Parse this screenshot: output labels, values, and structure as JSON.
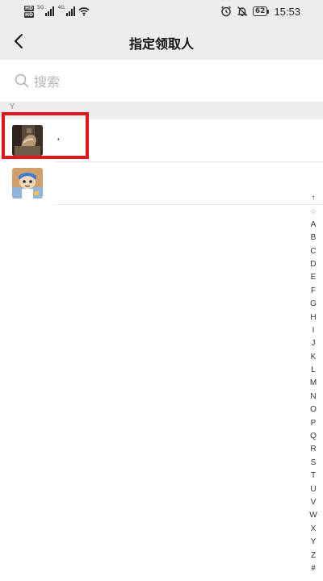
{
  "status_bar": {
    "sim_badges": [
      "HD",
      "HD"
    ],
    "network_labels": [
      "5G",
      "4G"
    ],
    "battery_level": "62",
    "time": "15:53"
  },
  "header": {
    "title": "指定领取人"
  },
  "search": {
    "placeholder": "搜索"
  },
  "section": {
    "letter": "Y"
  },
  "contacts": [
    {
      "name": "·",
      "highlighted": true
    },
    {
      "name": "",
      "highlighted": false
    }
  ],
  "index_bar": [
    "↑",
    "☆",
    "A",
    "B",
    "C",
    "D",
    "E",
    "F",
    "G",
    "H",
    "I",
    "J",
    "K",
    "L",
    "M",
    "N",
    "O",
    "P",
    "Q",
    "R",
    "S",
    "T",
    "U",
    "V",
    "W",
    "X",
    "Y",
    "Z",
    "#"
  ],
  "colors": {
    "background": "#ededed",
    "highlight_border": "#e3151a",
    "placeholder": "#b5b5b5"
  }
}
